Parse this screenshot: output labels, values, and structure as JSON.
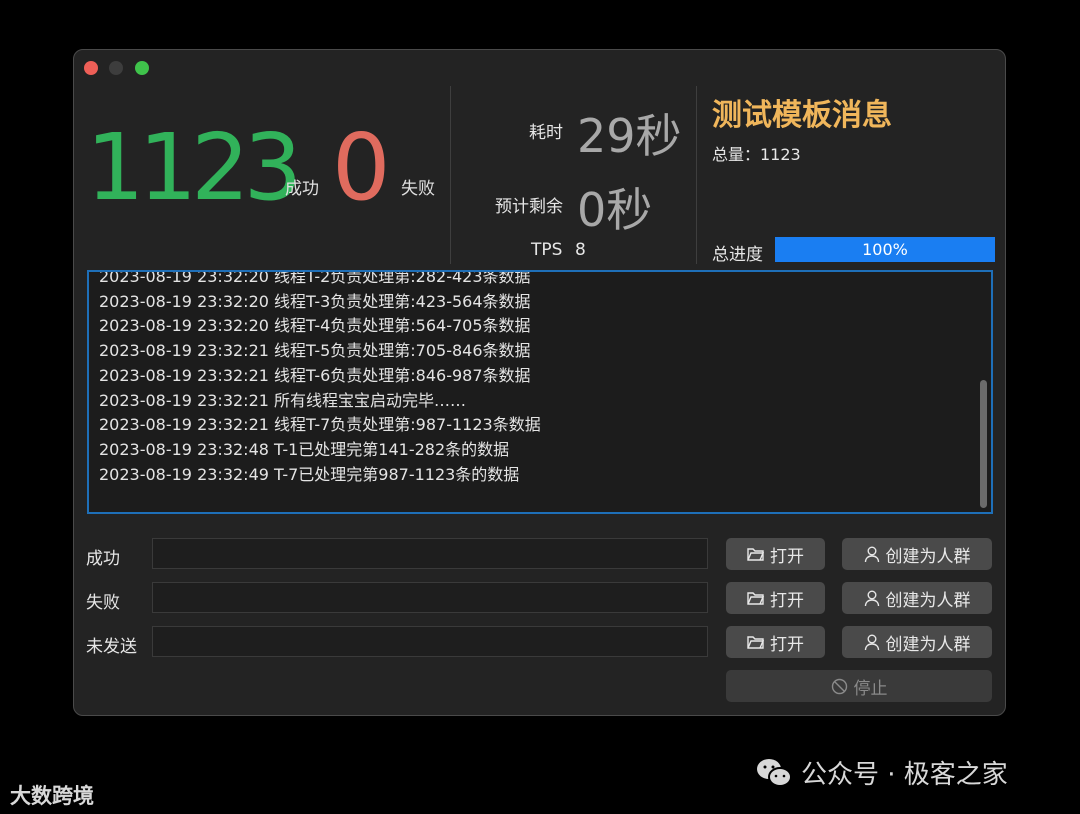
{
  "stats": {
    "success_count": "1123",
    "success_label": "成功",
    "fail_count": "0",
    "fail_label": "失败",
    "elapsed_label": "耗时",
    "elapsed_value": "29秒",
    "remaining_label": "预计剩余",
    "remaining_value": "0秒",
    "tps_label": "TPS",
    "tps_value": "8"
  },
  "info": {
    "title": "测试模板消息",
    "total_text": "总量：1123",
    "progress_label": "总进度",
    "progress_value": 1.0,
    "progress_text": "100%"
  },
  "log": [
    "2023-08-19 23:32:20 线程T-2负责处理第:282-423条数据",
    "2023-08-19 23:32:20 线程T-3负责处理第:423-564条数据",
    "2023-08-19 23:32:20 线程T-4负责处理第:564-705条数据",
    "2023-08-19 23:32:21 线程T-5负责处理第:705-846条数据",
    "2023-08-19 23:32:21 线程T-6负责处理第:846-987条数据",
    "2023-08-19 23:32:21 所有线程宝宝启动完毕……",
    "2023-08-19 23:32:21 线程T-7负责处理第:987-1123条数据",
    "2023-08-19 23:32:48 T-1已处理完第141-282条的数据",
    "2023-08-19 23:32:49 T-7已处理完第987-1123条的数据"
  ],
  "rows": [
    {
      "label": "成功",
      "value": "",
      "open_label": "打开",
      "create_label": "创建为人群"
    },
    {
      "label": "失败",
      "value": "",
      "open_label": "打开",
      "create_label": "创建为人群"
    },
    {
      "label": "未发送",
      "value": "",
      "open_label": "打开",
      "create_label": "创建为人群"
    }
  ],
  "stop_label": "停止",
  "watermark": {
    "left": "大数跨境",
    "right": "公众号 · 极客之家"
  },
  "colors": {
    "success": "#31b25a",
    "fail": "#e06b5e",
    "title": "#f0b65b",
    "progress": "#1a7ef2",
    "log_border": "#1e6fb8"
  }
}
